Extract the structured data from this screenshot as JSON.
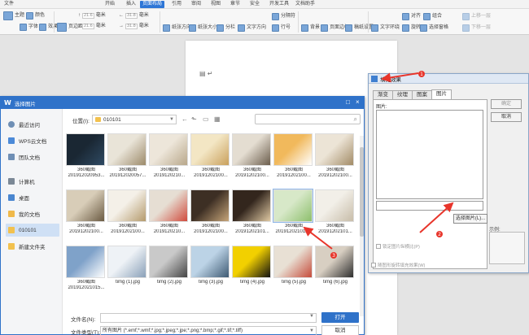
{
  "wps": {
    "menu": [
      "文件",
      "开始",
      "插入",
      "页面布局",
      "引用",
      "审阅",
      "视图",
      "章节",
      "安全",
      "开发工具",
      "文档助手"
    ],
    "active_menu_index": 3,
    "ribbon": {
      "theme": "主题",
      "colors": "颜色",
      "font": "字体",
      "effect": "效果",
      "margins": "页边距",
      "margin_values": [
        "21.6",
        "21.6",
        "31.8",
        "31.8"
      ],
      "margin_unit": "毫米",
      "orientation": "纸张方向",
      "size": "纸张大小",
      "columns": "分栏",
      "text_direction": "文字方向",
      "line_numbers": "行号",
      "breaks": "分隔符",
      "background": "背景",
      "page_border": "页面边框",
      "draft_setting": "稿纸设置",
      "wrap_text": "文字环绕",
      "align": "对齐",
      "rotate": "旋转",
      "selection_pane": "选择窗格",
      "combine": "组合",
      "up_one": "上移一层",
      "down_one": "下移一层"
    }
  },
  "fill_dialog": {
    "title": "填充效果",
    "tabs": [
      "渐变",
      "纹理",
      "图案",
      "图片"
    ],
    "active_tab_index": 3,
    "picture_label": "图片:",
    "select_picture": "选择图片(L)...",
    "lock_aspect": "锁定图片纵横比(P)",
    "rotate_with_shape": "随图形旋转填充效果(W)",
    "ok": "确定",
    "cancel": "取消",
    "sample": "示例:"
  },
  "picture_dialog": {
    "logo": "W",
    "title": "选择图片",
    "sidebar": [
      {
        "label": "最近访问",
        "icon": "clock-icon"
      },
      {
        "label": "WPS云文档",
        "icon": "cloud-icon"
      },
      {
        "label": "团队文档",
        "icon": "team-icon"
      },
      {
        "label": "计算机",
        "icon": "computer-icon"
      },
      {
        "label": "桌面",
        "icon": "desktop-icon"
      },
      {
        "label": "我的文档",
        "icon": "documents-icon"
      },
      {
        "label": "010101",
        "icon": "folder-icon"
      },
      {
        "label": "新建文件夹",
        "icon": "folder-icon"
      }
    ],
    "selected_sidebar_index": 6,
    "location_label": "位置(I):",
    "location_value": "010101",
    "search_placeholder": "",
    "files": [
      {
        "name": "360截图",
        "date": "201912020953...",
        "colors": [
          "#1a2733",
          "#2f4a63"
        ]
      },
      {
        "name": "360截图",
        "date": "201912020057...",
        "colors": [
          "#e9e4d8",
          "#9c8a6a"
        ]
      },
      {
        "name": "360截图",
        "date": "2019120210...",
        "colors": [
          "#ede6da",
          "#b8a78a"
        ]
      },
      {
        "name": "360截图",
        "date": "20191202100...",
        "colors": [
          "#f3e6c4",
          "#c9a05c"
        ]
      },
      {
        "name": "360截图",
        "date": "20191202100...",
        "colors": [
          "#e4ddd1",
          "#6b5d4c"
        ]
      },
      {
        "name": "360截图",
        "date": "20191202100...",
        "colors": [
          "#f1b95c",
          "#ffffff"
        ]
      },
      {
        "name": "360截图",
        "date": "20191202100...",
        "colors": [
          "#ece4d6",
          "#a28b66"
        ]
      },
      {
        "name": "360截图",
        "date": "20191202100...",
        "colors": [
          "#d8cdb8",
          "#6a5a42"
        ]
      },
      {
        "name": "360截图",
        "date": "20191202100...",
        "colors": [
          "#f4f0e8",
          "#b49a6c"
        ]
      },
      {
        "name": "360截图",
        "date": "2019120210...",
        "colors": [
          "#e6ded3",
          "#d04a3c"
        ]
      },
      {
        "name": "360截图",
        "date": "20191202100...",
        "colors": [
          "#3d2f24",
          "#c7a57a"
        ]
      },
      {
        "name": "360截图",
        "date": "20191202101...",
        "colors": [
          "#33261d",
          "#e0c9a3"
        ]
      },
      {
        "name": "360截图",
        "date": "201912021012...",
        "colors": [
          "#d7e8c8",
          "#8dbf6c"
        ]
      },
      {
        "name": "360截图",
        "date": "20191202101...",
        "colors": [
          "#f2efe8",
          "#c7bca8"
        ]
      },
      {
        "name": "360截图",
        "date": "201912021015...",
        "colors": [
          "#7fa2c9",
          "#ffffff"
        ]
      },
      {
        "name": "timg (1).jpg",
        "date": "",
        "colors": [
          "#eef2f6",
          "#8aa0b8"
        ]
      },
      {
        "name": "timg (2).jpg",
        "date": "",
        "colors": [
          "#c9c9c9",
          "#444444"
        ]
      },
      {
        "name": "timg (3).jpg",
        "date": "",
        "colors": [
          "#bcd3e6",
          "#3e5a73"
        ]
      },
      {
        "name": "timg (4).jpg",
        "date": "",
        "colors": [
          "#f2d000",
          "#111111"
        ]
      },
      {
        "name": "timg (5).jpg",
        "date": "",
        "colors": [
          "#e8e0d4",
          "#c64b3a"
        ]
      },
      {
        "name": "timg (6).jpg",
        "date": "",
        "colors": [
          "#d8cfc2",
          "#2d2d2d"
        ]
      }
    ],
    "highlighted_file_index": 12,
    "file_name_label": "文件名(N):",
    "file_name_value": "",
    "file_type_label": "文件类型(T):",
    "file_type_value": "所有图片 (*.emf;*.wmf;*.jpg;*.jpeg;*.jpe;*.png;*.bmp;*.gif;*.tif;*.tiff)",
    "open": "打开",
    "cancel": "取消"
  },
  "annotations": [
    {
      "number": "1"
    },
    {
      "number": "2"
    },
    {
      "number": "3"
    }
  ],
  "colors": {
    "accent": "#2f72c9",
    "arrow": "#e8352b"
  }
}
